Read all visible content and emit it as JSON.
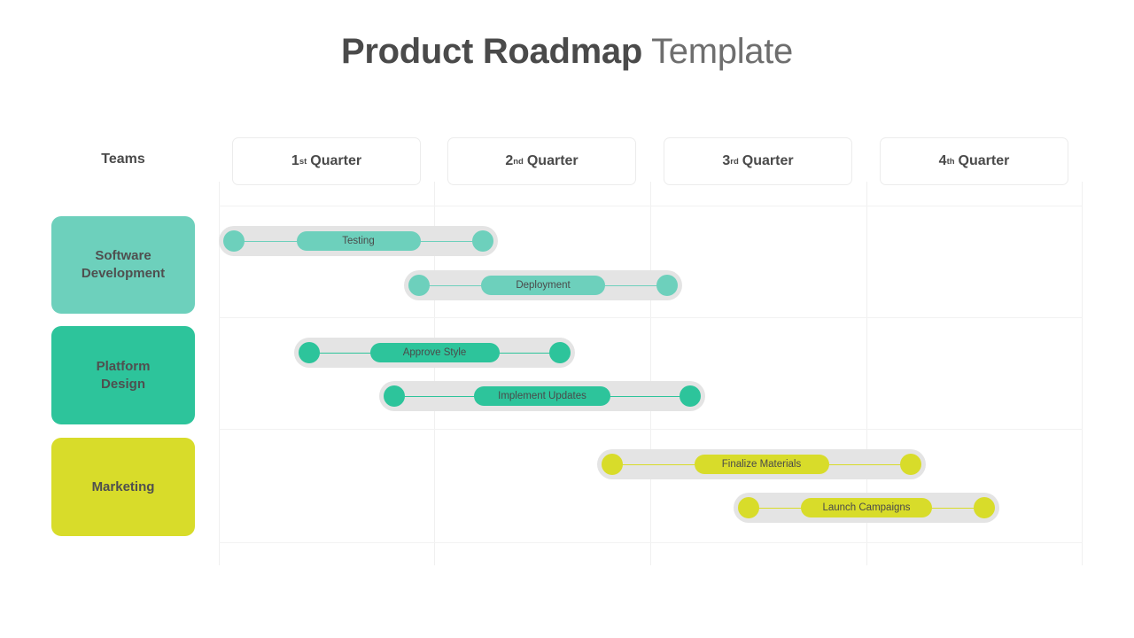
{
  "title": {
    "strong": "Product Roadmap",
    "light": " Template"
  },
  "teams_heading": "Teams",
  "colors": {
    "software_development": "#6dd0bc",
    "platform_design": "#2dc49b",
    "marketing": "#d8dc2a",
    "track": "#e4e4e4",
    "title_strong": "#4a4a4a",
    "title_light": "#6e6e6e",
    "grid": "#f0f0f0"
  },
  "quarters": [
    {
      "num": "1",
      "ord": "st",
      "word": "Quarter",
      "label": "1st Quarter"
    },
    {
      "num": "2",
      "ord": "nd",
      "word": "Quarter",
      "label": "2nd Quarter"
    },
    {
      "num": "3",
      "ord": "rd",
      "word": "Quarter",
      "label": "3rd Quarter"
    },
    {
      "num": "4",
      "ord": "th",
      "word": "Quarter",
      "label": "4th Quarter"
    }
  ],
  "teams": [
    {
      "name": "Software Development",
      "line1": "Software",
      "line2": "Development",
      "color": "#6dd0bc"
    },
    {
      "name": "Platform Design",
      "line1": "Platform",
      "line2": "Design",
      "color": "#2dc49b"
    },
    {
      "name": "Marketing",
      "line1": "Marketing",
      "line2": "",
      "color": "#d8dc2a"
    }
  ],
  "tasks": [
    {
      "label": "Testing",
      "team": "Software Development",
      "color": "#6dd0bc",
      "pill_width": 140
    },
    {
      "label": "Deployment",
      "team": "Software Development",
      "color": "#6dd0bc",
      "pill_width": 140
    },
    {
      "label": "Approve Style",
      "team": "Platform Design",
      "color": "#2dc49b",
      "pill_width": 146
    },
    {
      "label": "Implement Updates",
      "team": "Platform Design",
      "color": "#2dc49b",
      "pill_width": 154
    },
    {
      "label": "Finalize Materials",
      "team": "Marketing",
      "color": "#d8dc2a",
      "pill_width": 152
    },
    {
      "label": "Launch Campaigns",
      "team": "Marketing",
      "color": "#d8dc2a",
      "pill_width": 148
    }
  ]
}
